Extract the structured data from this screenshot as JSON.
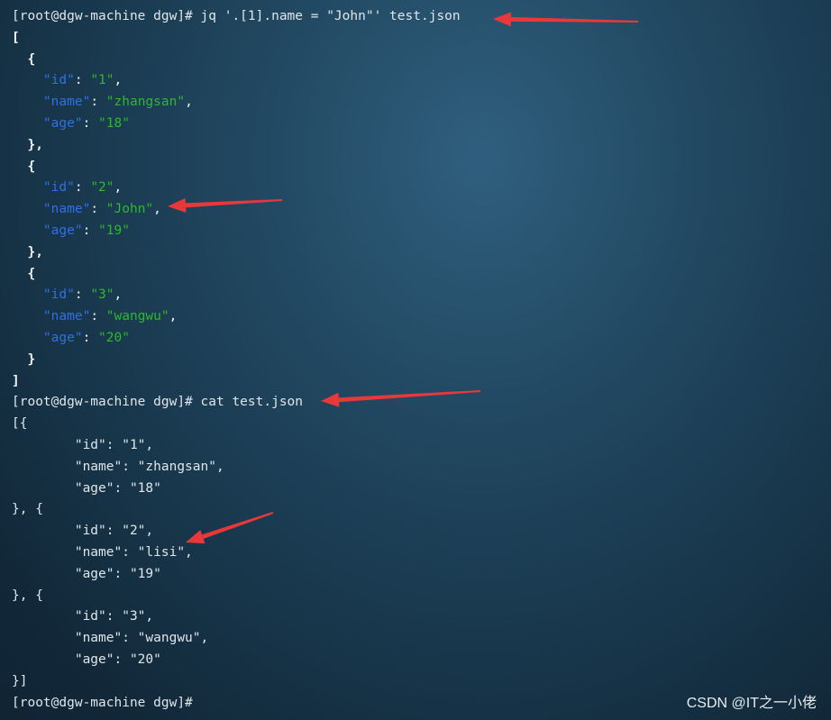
{
  "terminal": {
    "lines": [
      {
        "type": "prompt",
        "prompt": "[root@dgw-machine dgw]#",
        "command": " jq '.[1].name = \"John\"' test.json"
      },
      {
        "type": "jq",
        "text": "["
      },
      {
        "type": "jq",
        "text": "  {"
      },
      {
        "type": "jq-kv",
        "indent": "    ",
        "key": "\"id\"",
        "value": "\"1\"",
        "trail": ","
      },
      {
        "type": "jq-kv",
        "indent": "    ",
        "key": "\"name\"",
        "value": "\"zhangsan\"",
        "trail": ","
      },
      {
        "type": "jq-kv",
        "indent": "    ",
        "key": "\"age\"",
        "value": "\"18\"",
        "trail": ""
      },
      {
        "type": "jq",
        "text": "  },"
      },
      {
        "type": "jq",
        "text": "  {"
      },
      {
        "type": "jq-kv",
        "indent": "    ",
        "key": "\"id\"",
        "value": "\"2\"",
        "trail": ","
      },
      {
        "type": "jq-kv",
        "indent": "    ",
        "key": "\"name\"",
        "value": "\"John\"",
        "trail": ","
      },
      {
        "type": "jq-kv",
        "indent": "    ",
        "key": "\"age\"",
        "value": "\"19\"",
        "trail": ""
      },
      {
        "type": "jq",
        "text": "  },"
      },
      {
        "type": "jq",
        "text": "  {"
      },
      {
        "type": "jq-kv",
        "indent": "    ",
        "key": "\"id\"",
        "value": "\"3\"",
        "trail": ","
      },
      {
        "type": "jq-kv",
        "indent": "    ",
        "key": "\"name\"",
        "value": "\"wangwu\"",
        "trail": ","
      },
      {
        "type": "jq-kv",
        "indent": "    ",
        "key": "\"age\"",
        "value": "\"20\"",
        "trail": ""
      },
      {
        "type": "jq",
        "text": "  }"
      },
      {
        "type": "jq",
        "text": "]"
      },
      {
        "type": "prompt",
        "prompt": "[root@dgw-machine dgw]#",
        "command": " cat test.json"
      },
      {
        "type": "plain",
        "text": "[{"
      },
      {
        "type": "plain",
        "text": "\t\"id\": \"1\","
      },
      {
        "type": "plain",
        "text": "\t\"name\": \"zhangsan\","
      },
      {
        "type": "plain",
        "text": "\t\"age\": \"18\""
      },
      {
        "type": "plain",
        "text": "}, {"
      },
      {
        "type": "plain",
        "text": "\t\"id\": \"2\","
      },
      {
        "type": "plain",
        "text": "\t\"name\": \"lisi\","
      },
      {
        "type": "plain",
        "text": "\t\"age\": \"19\""
      },
      {
        "type": "plain",
        "text": "}, {"
      },
      {
        "type": "plain",
        "text": "\t\"id\": \"3\","
      },
      {
        "type": "plain",
        "text": "\t\"name\": \"wangwu\","
      },
      {
        "type": "plain",
        "text": "\t\"age\": \"20\""
      },
      {
        "type": "plain",
        "text": "}]"
      },
      {
        "type": "prompt",
        "prompt": "[root@dgw-machine dgw]#",
        "command": ""
      }
    ]
  },
  "annotations": {
    "arrow_color": "#e8383a"
  },
  "watermark": "CSDN @IT之一小佬"
}
